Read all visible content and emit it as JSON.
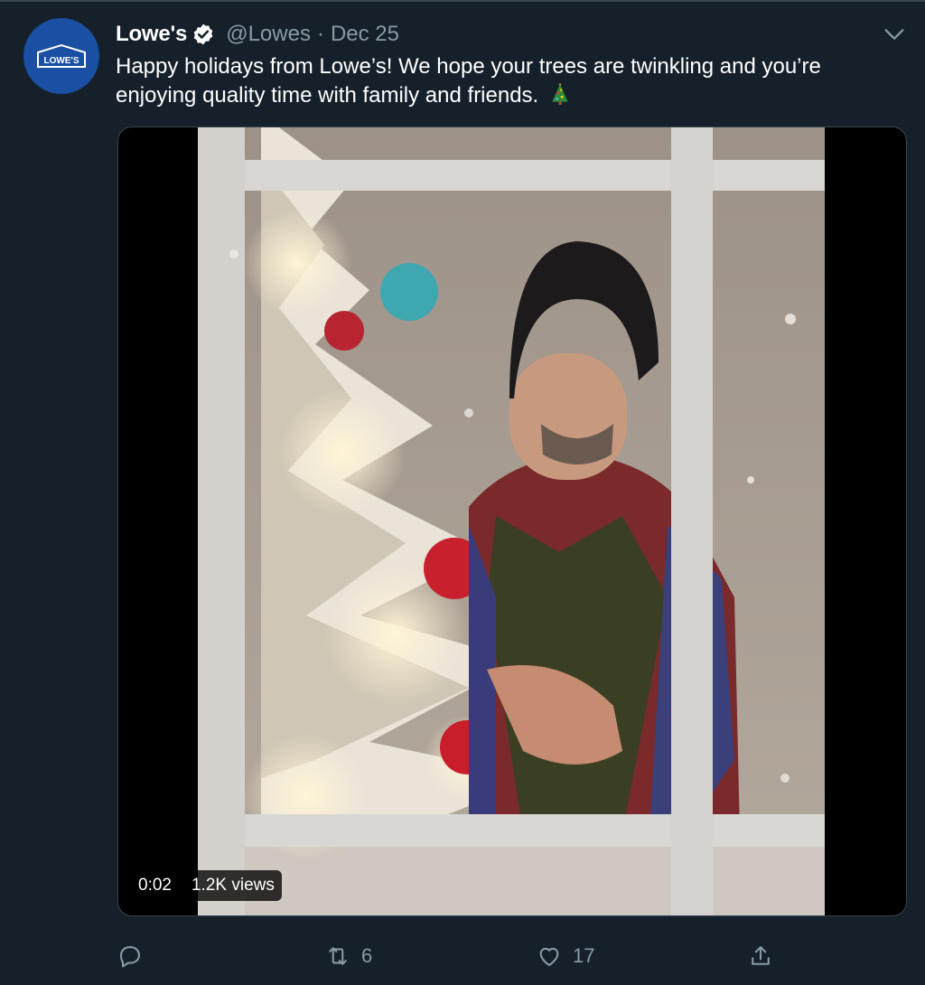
{
  "tweet": {
    "author_name": "Lowe's",
    "handle": "@Lowes",
    "separator": "·",
    "date": "Dec 25",
    "text": "Happy holidays from Lowe’s! We hope your trees are twinkling and you’re enjoying quality time with family and friends.",
    "avatar_logo_text": "LOWE'S",
    "verified": true,
    "emoji": "christmas-tree"
  },
  "media": {
    "type": "video",
    "timestamp": "0:02",
    "views": "1.2K views"
  },
  "actions": {
    "reply": {
      "icon": "reply-icon",
      "count": ""
    },
    "retweet": {
      "icon": "retweet-icon",
      "count": "6"
    },
    "like": {
      "icon": "heart-icon",
      "count": "17"
    },
    "share": {
      "icon": "share-icon"
    }
  },
  "colors": {
    "background": "#15202b",
    "secondary_text": "#8899a6",
    "border": "#38444d",
    "avatar": "#1b4fa3"
  }
}
